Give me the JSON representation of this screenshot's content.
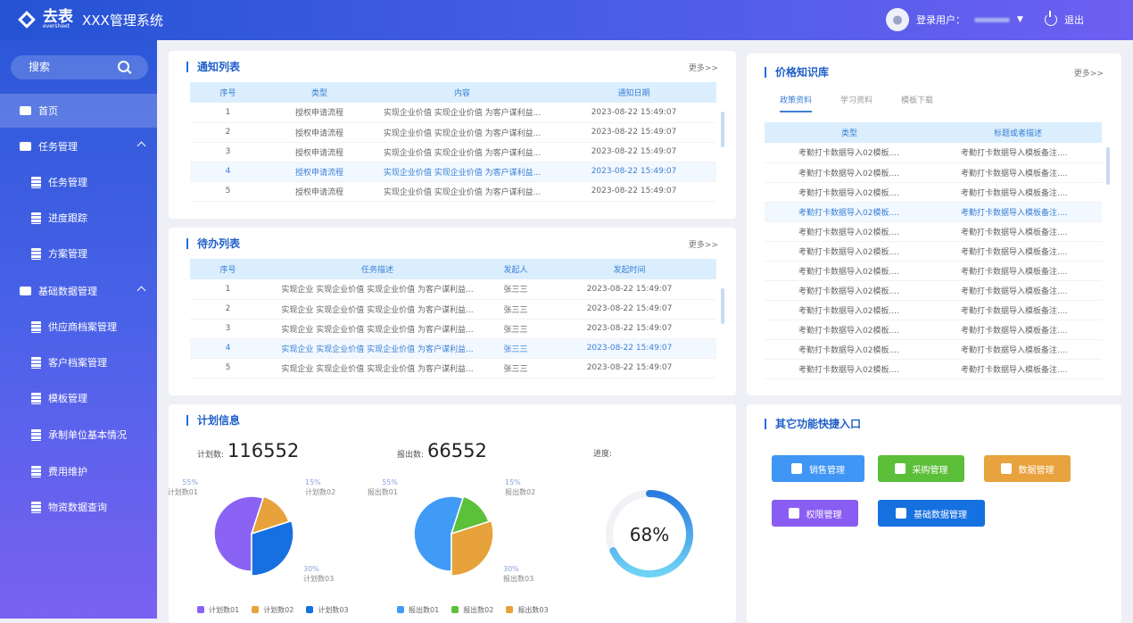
{
  "header": {
    "brand": "去表",
    "brand_sub": "eversheet",
    "title": "XXX管理系统",
    "user_label": "登录用户：",
    "logout": "退出"
  },
  "sidebar": {
    "search": "搜索",
    "items": [
      {
        "label": "首页",
        "level": 0,
        "active": true
      },
      {
        "label": "任务管理",
        "level": 0,
        "expanded": true
      },
      {
        "label": "任务管理",
        "level": 1
      },
      {
        "label": "进度跟踪",
        "level": 1
      },
      {
        "label": "方案管理",
        "level": 1
      },
      {
        "label": "基础数据管理",
        "level": 0,
        "expanded": true
      },
      {
        "label": "供应商档案管理",
        "level": 1
      },
      {
        "label": "客户档案管理",
        "level": 1
      },
      {
        "label": "模板管理",
        "level": 1
      },
      {
        "label": "承制单位基本情况",
        "level": 1
      },
      {
        "label": "费用维护",
        "level": 1
      },
      {
        "label": "物资数据查询",
        "level": 1
      }
    ]
  },
  "notice": {
    "title": "通知列表",
    "more": "更多>>",
    "columns": [
      "序号",
      "类型",
      "内容",
      "通知日期"
    ],
    "rows": [
      [
        "1",
        "授权申请流程",
        "实现企业价值 实现企业价值 为客户谋利益...",
        "2023-08-22 15:49:07"
      ],
      [
        "2",
        "授权申请流程",
        "实现企业价值 实现企业价值 为客户谋利益...",
        "2023-08-22 15:49:07"
      ],
      [
        "3",
        "授权申请流程",
        "实现企业价值 实现企业价值 为客户谋利益...",
        "2023-08-22 15:49:07"
      ],
      [
        "4",
        "授权申请流程",
        "实现企业价值 实现企业价值 为客户谋利益...",
        "2023-08-22 15:49:07"
      ],
      [
        "5",
        "授权申请流程",
        "实现企业价值 实现企业价值 为客户谋利益...",
        "2023-08-22 15:49:07"
      ]
    ]
  },
  "todo": {
    "title": "待办列表",
    "more": "更多>>",
    "columns": [
      "序号",
      "任务描述",
      "发起人",
      "发起时间"
    ],
    "rows": [
      [
        "1",
        "实现企业 实现企业价值 实现企业价值 为客户谋利益...",
        "张三三",
        "2023-08-22 15:49:07"
      ],
      [
        "2",
        "实现企业 实现企业价值 实现企业价值 为客户谋利益...",
        "张三三",
        "2023-08-22 15:49:07"
      ],
      [
        "3",
        "实现企业 实现企业价值 实现企业价值 为客户谋利益...",
        "张三三",
        "2023-08-22 15:49:07"
      ],
      [
        "4",
        "实现企业 实现企业价值 实现企业价值 为客户谋利益...",
        "张三三",
        "2023-08-22 15:49:07"
      ],
      [
        "5",
        "实现企业 实现企业价值 实现企业价值 为客户谋利益...",
        "张三三",
        "2023-08-22 15:49:07"
      ]
    ]
  },
  "knowledge": {
    "title": "价格知识库",
    "more": "更多>>",
    "tabs": [
      "政策资料",
      "学习资料",
      "模板下载"
    ],
    "active_tab": 0,
    "columns": [
      "类型",
      "标题或者描述"
    ],
    "rows": [
      [
        "考勤打卡数据导入02模板....",
        "考勤打卡数据导入模板备注...."
      ],
      [
        "考勤打卡数据导入02模板....",
        "考勤打卡数据导入模板备注...."
      ],
      [
        "考勤打卡数据导入02模板....",
        "考勤打卡数据导入模板备注...."
      ],
      [
        "考勤打卡数据导入02模板....",
        "考勤打卡数据导入模板备注...."
      ],
      [
        "考勤打卡数据导入02模板....",
        "考勤打卡数据导入模板备注...."
      ],
      [
        "考勤打卡数据导入02模板....",
        "考勤打卡数据导入模板备注...."
      ],
      [
        "考勤打卡数据导入02模板....",
        "考勤打卡数据导入模板备注...."
      ],
      [
        "考勤打卡数据导入02模板....",
        "考勤打卡数据导入模板备注...."
      ],
      [
        "考勤打卡数据导入02模板....",
        "考勤打卡数据导入模板备注...."
      ],
      [
        "考勤打卡数据导入02模板....",
        "考勤打卡数据导入模板备注...."
      ],
      [
        "考勤打卡数据导入02模板....",
        "考勤打卡数据导入模板备注...."
      ],
      [
        "考勤打卡数据导入02模板....",
        "考勤打卡数据导入模板备注...."
      ]
    ]
  },
  "plan": {
    "title": "计划信息",
    "plan_label": "计划数:",
    "plan_value": "116552",
    "report_label": "报出数:",
    "report_value": "66552",
    "progress_label": "进度:",
    "progress_text": "68%"
  },
  "chart_data": [
    {
      "type": "pie",
      "variant": "rose",
      "series": [
        {
          "name": "计划数01",
          "value": 55,
          "label": "55%",
          "color": "#8a63f4"
        },
        {
          "name": "计划数02",
          "value": 15,
          "label": "15%",
          "color": "#e8a23b"
        },
        {
          "name": "计划数03",
          "value": 30,
          "label": "30%",
          "color": "#1670e0"
        }
      ],
      "legend": "bottom"
    },
    {
      "type": "pie",
      "variant": "rose",
      "series": [
        {
          "name": "报出数01",
          "value": 55,
          "label": "55%",
          "color": "#3f9bf6"
        },
        {
          "name": "报出数02",
          "value": 15,
          "label": "15%",
          "color": "#5cc13a"
        },
        {
          "name": "报出数03",
          "value": 30,
          "label": "30%",
          "color": "#e8a23b"
        }
      ],
      "legend": "bottom"
    },
    {
      "type": "gauge",
      "value": 68,
      "label": "68%"
    }
  ],
  "shortcuts": {
    "title": "其它功能快捷入口",
    "buttons": [
      {
        "label": "销售管理",
        "icon": "user-icon",
        "color": "#3f96f4"
      },
      {
        "label": "采购管理",
        "icon": "cart-icon",
        "color": "#5cbf3a"
      },
      {
        "label": "数据管理",
        "icon": "clipboard-chart-icon",
        "color": "#e8a23e"
      },
      {
        "label": "权限管理",
        "icon": "shield-icon",
        "color": "#8a5df2"
      },
      {
        "label": "基础数据管理",
        "icon": "bar-chart-icon",
        "color": "#1570e0"
      }
    ]
  }
}
